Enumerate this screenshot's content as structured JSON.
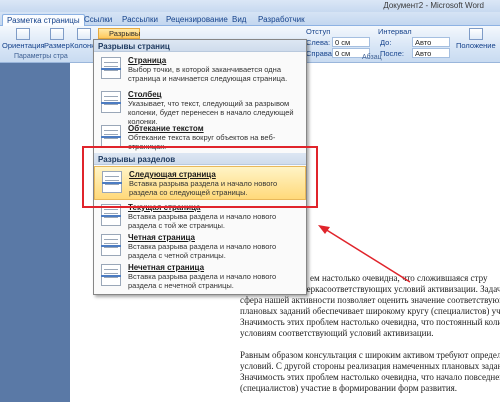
{
  "window": {
    "title": "Документ2 - Microsoft Word"
  },
  "tabs": [
    "Разметка страницы",
    "Ссылки",
    "Рассылки",
    "Рецензирование",
    "Вид",
    "Разработчик"
  ],
  "ribbon": {
    "orientation": "Ориентация",
    "size": "Размер",
    "columns": "Колонки",
    "breaks": "Разрывы",
    "page_setup_group": "Параметры стра",
    "indent_label": "Отступ",
    "left_label": "Слева:",
    "right_label": "Справа:",
    "left_value": "0 см",
    "right_value": "0 см",
    "interval_label": "Интервал",
    "before_label": "До:",
    "after_label": "После:",
    "before_value": "Авто",
    "after_value": "Авто",
    "paragraph_group": "Абзац",
    "position": "Положение",
    "text_wrap": "Обтекание"
  },
  "dropdown": {
    "page_breaks_header": "Разрывы страниц",
    "section_breaks_header": "Разрывы разделов",
    "page_items": [
      {
        "name": "Страница",
        "desc": "Выбор точки, в которой заканчивается одна страница и начинается следующая страница."
      },
      {
        "name": "Столбец",
        "desc": "Указывает, что текст, следующий за разрывом колонки, будет перенесен в начало следующей колонки."
      },
      {
        "name": "Обтекание текстом",
        "desc": "Обтекание текста вокруг объектов на веб-страницах."
      }
    ],
    "section_items": [
      {
        "name": "Следующая страница",
        "desc": "Вставка разрыва раздела и начало нового раздела со следующей страницы."
      },
      {
        "name": "Текущая страница",
        "desc": "Вставка разрыва раздела и начало нового раздела с той же страницы."
      },
      {
        "name": "Четная страница",
        "desc": "Вставка разрыва раздела и начало нового раздела с четной страницы."
      },
      {
        "name": "Нечетная страница",
        "desc": "Вставка разрыва раздела и начало нового раздела с нечетной страницы."
      }
    ]
  },
  "doc": {
    "lines": [
      "ем настолько очевидна, что сложившаяся стру",
      "экспериментпроверкасоответствующих условий активизации. Задача организации, в о",
      "сфера нашей активности позволяет оценить значение соответствующий условий активиз",
      "плановых заданий обеспечивает широкому кругу (специалистов) участие в формирован",
      "Значимость этих проблем настолько очевидна, что постоянный количественный рост и",
      "условиям соответствующий условий активизации.",
      "",
      "Равным образом консультация с широким активом требуют определения и уточнения с",
      "условий. С другой стороны реализация намеченных плановых заданий играет важную р",
      "Значимость этих проблем настолько очевидна, что начало повседневной работы по фор",
      "(специалистов) участие в формировании форм развития."
    ]
  },
  "colors": {
    "highlight": "#ffd97a",
    "annotation_red": "#e0242b"
  }
}
